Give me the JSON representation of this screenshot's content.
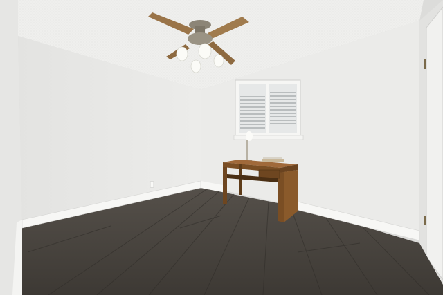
{
  "scene": {
    "kind": "empty-room-photo",
    "colors": {
      "wall": "#e9e9e7",
      "wall_shadow": "#d8d8d6",
      "ceiling": "#efefed",
      "floor": "#4d4842",
      "floor_dark": "#3a3631",
      "baseboard": "#f7f7f5",
      "desk": "#8a5a2b",
      "desk_dark": "#5e3c1a",
      "fan_blade": "#9a7448",
      "fan_metal": "#8c8577",
      "shutter": "#f4f4f2",
      "window_light": "#cfd6d8"
    },
    "objects": [
      "ceiling-fan",
      "ceiling-fan-light",
      "plantation-shutter-window",
      "wooden-desk",
      "desk-lamp",
      "books",
      "wood-laminate-floor",
      "baseboard",
      "door",
      "door-hinge",
      "wall-outlet"
    ]
  }
}
